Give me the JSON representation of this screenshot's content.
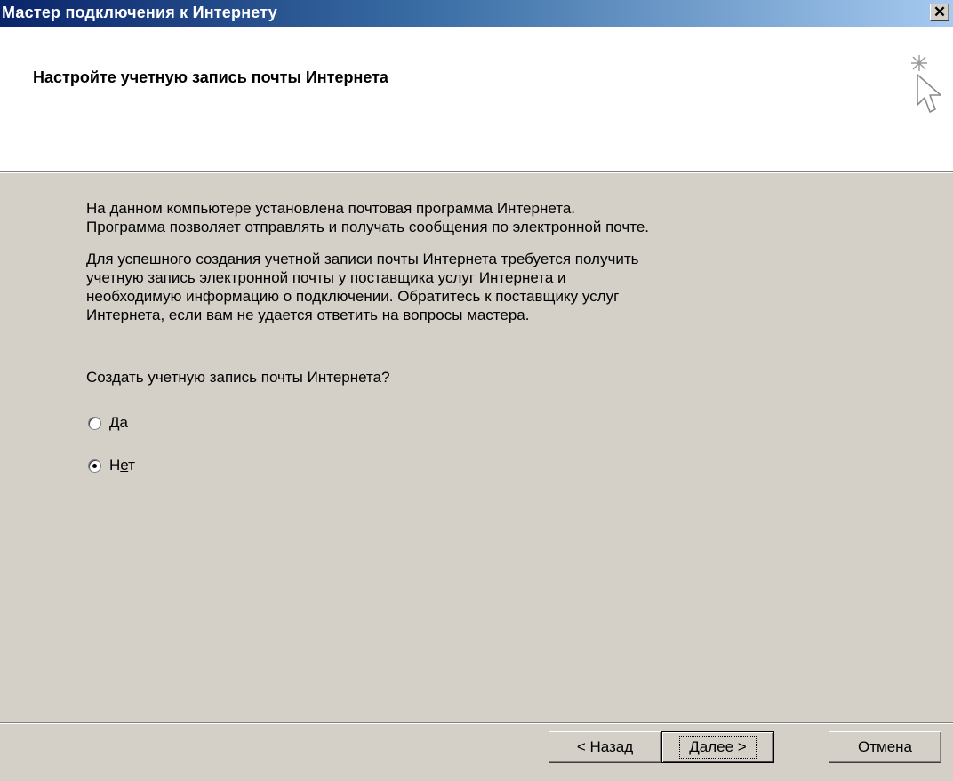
{
  "window": {
    "title": "Мастер подключения к Интернету",
    "close_glyph": "✕"
  },
  "header": {
    "heading": "Настройте учетную запись почты Интернета",
    "icon": "wizard-pointer-icon"
  },
  "content": {
    "paragraph1": "На данном компьютере установлена почтовая программа Интернета.\nПрограмма позволяет отправлять и получать сообщения по электронной почте.",
    "paragraph2": "Для успешного создания учетной записи почты Интернета требуется получить\nучетную запись электронной почты у поставщика услуг Интернета и\nнеобходимую информацию о подключении. Обратитесь к поставщику услуг\nИнтернета, если вам не удается ответить на вопросы мастера.",
    "question": "Создать учетную запись почты Интернета?"
  },
  "radios": [
    {
      "label_pre": "",
      "label_u": "Д",
      "label_post": "а",
      "checked": false
    },
    {
      "label_pre": "Н",
      "label_u": "е",
      "label_post": "т",
      "checked": true
    }
  ],
  "buttons": {
    "back": {
      "pre": "< ",
      "u": "Н",
      "post": "азад"
    },
    "next": {
      "pre": "",
      "u": "Д",
      "post": "алее >"
    },
    "cancel": "Отмена"
  },
  "colors": {
    "titlebar_start": "#0a246a",
    "titlebar_end": "#a6caf0",
    "face": "#d4d0c8"
  }
}
